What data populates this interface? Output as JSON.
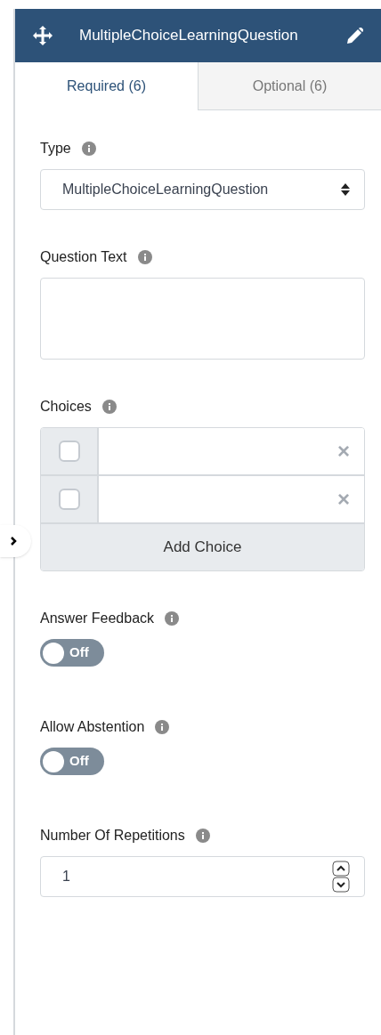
{
  "header": {
    "title": "MultipleChoiceLearningQuestion"
  },
  "tabs": [
    {
      "label": "Required (6)",
      "selected": true
    },
    {
      "label": "Optional (6)",
      "selected": false
    }
  ],
  "fields": [
    {
      "kind": "select",
      "label": "Type",
      "value": "MultipleChoiceLearningQuestion"
    },
    {
      "kind": "textarea",
      "label": "Question Text"
    },
    {
      "kind": "choices",
      "label": "Choices",
      "choices": [
        {
          "checked": false,
          "remove": "×"
        },
        {
          "checked": false,
          "remove": "×"
        }
      ],
      "add_button": "Add Choice"
    },
    {
      "kind": "toggle",
      "label": "Answer Feedback",
      "on": false,
      "state_label": "Off"
    },
    {
      "kind": "toggle",
      "label": "Allow Abstention",
      "on": false,
      "state_label": "Off"
    },
    {
      "kind": "number",
      "label": "Number Of Repetitions",
      "value": "1"
    }
  ]
}
